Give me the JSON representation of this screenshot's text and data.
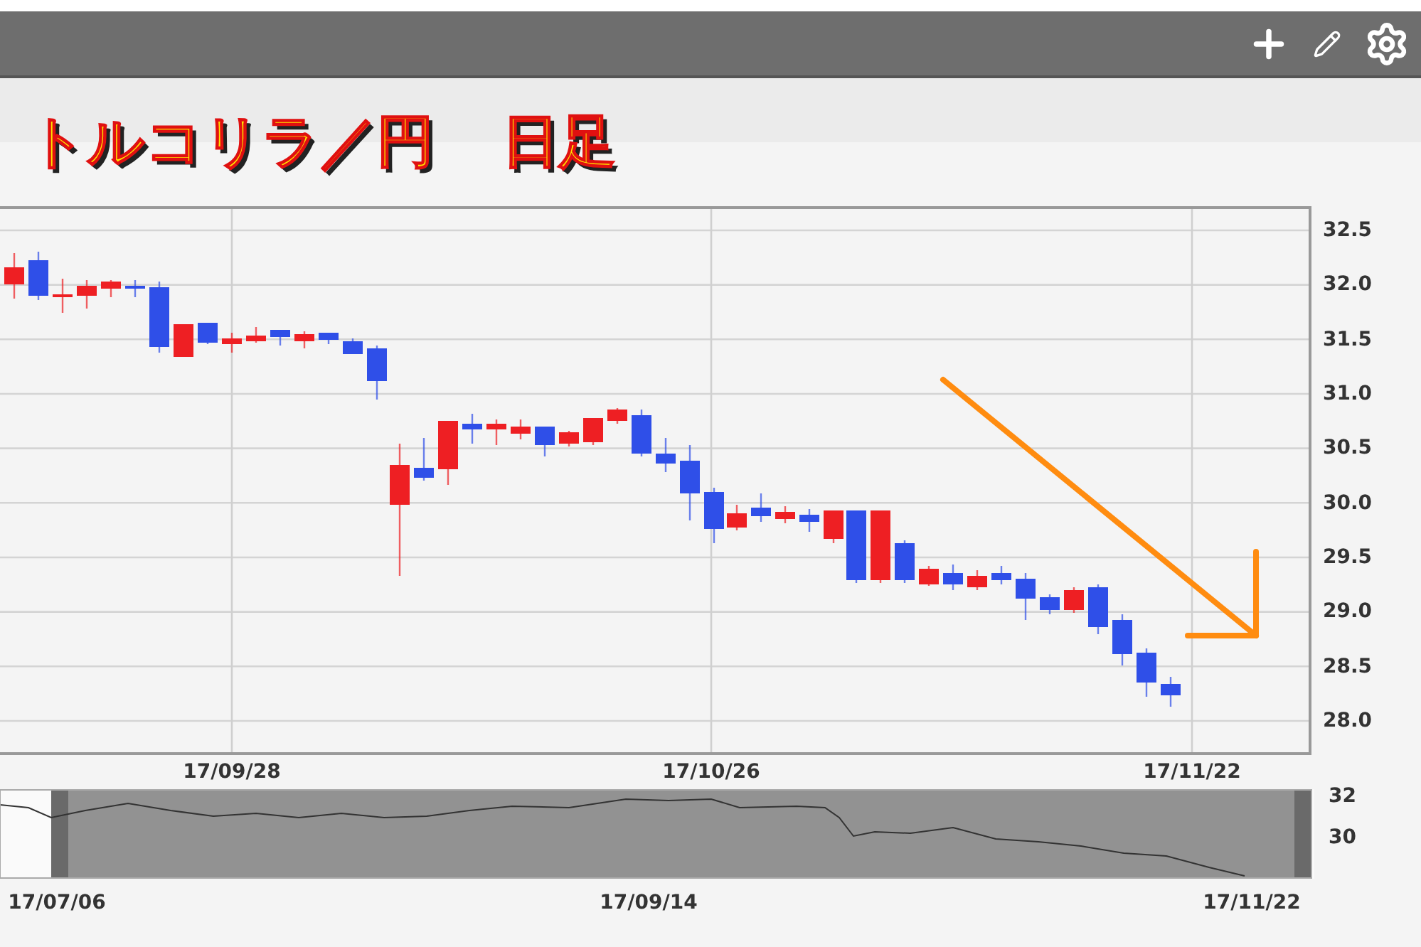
{
  "title": {
    "pair": "トルコリラ／円",
    "timeframe": "日足"
  },
  "chart": {
    "yticks": [
      "32.5",
      "32.0",
      "31.5",
      "31.0",
      "30.5",
      "30.0",
      "29.5",
      "29.0",
      "28.5",
      "28.0"
    ],
    "xlabels": [
      "17/09/28",
      "17/10/26",
      "17/11/22"
    ]
  },
  "navigator": {
    "yticks": [
      "32",
      "30"
    ],
    "xlabels": [
      "17/07/06",
      "17/09/14",
      "17/11/22"
    ]
  }
}
